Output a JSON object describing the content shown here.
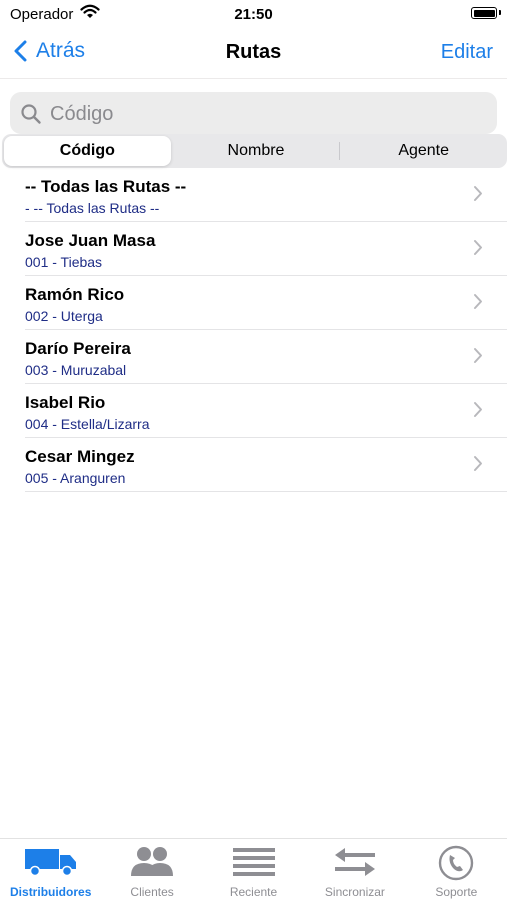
{
  "status_bar": {
    "carrier": "Operador",
    "time": "21:50"
  },
  "nav": {
    "back_label": "Atrás",
    "title": "Rutas",
    "edit_label": "Editar"
  },
  "search": {
    "placeholder": "Código",
    "value": ""
  },
  "segments": [
    {
      "label": "Código",
      "active": true
    },
    {
      "label": "Nombre",
      "active": false
    },
    {
      "label": "Agente",
      "active": false
    }
  ],
  "routes": [
    {
      "title": "-- Todas las Rutas --",
      "subtitle": "- -- Todas las Rutas --"
    },
    {
      "title": "Jose Juan Masa",
      "subtitle": "001 - Tiebas"
    },
    {
      "title": "Ramón Rico",
      "subtitle": "002 - Uterga"
    },
    {
      "title": "Darío Pereira",
      "subtitle": "003 - Muruzabal"
    },
    {
      "title": "Isabel Rio",
      "subtitle": "004 - Estella/Lizarra"
    },
    {
      "title": "Cesar Mingez",
      "subtitle": "005 - Aranguren"
    }
  ],
  "tabs": [
    {
      "label": "Distribuidores",
      "icon": "truck-icon",
      "active": true
    },
    {
      "label": "Clientes",
      "icon": "people-icon",
      "active": false
    },
    {
      "label": "Reciente",
      "icon": "list-lines-icon",
      "active": false
    },
    {
      "label": "Sincronizar",
      "icon": "sync-arrows-icon",
      "active": false
    },
    {
      "label": "Soporte",
      "icon": "phone-icon",
      "active": false
    }
  ],
  "colors": {
    "accent": "#1d7fe8",
    "subtitle": "#1f2d86",
    "inactive": "#8e8e93"
  }
}
